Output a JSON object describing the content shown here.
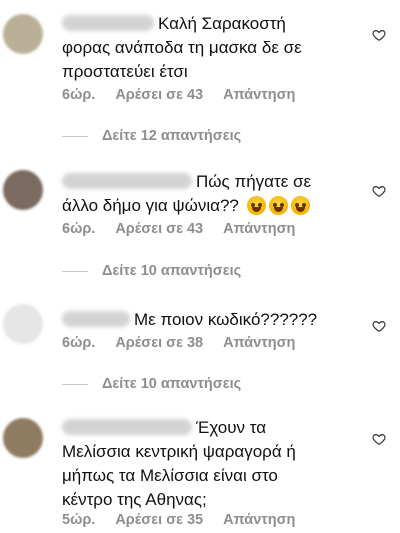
{
  "comments": [
    {
      "text": "Καλή Σαρακοστή\nφορας ανάποδα τη μασκα δε σε\nπροστατεύει έτσι",
      "time": "6ώρ.",
      "likes": "Αρέσει σε 43",
      "reply": "Απάντηση",
      "avatar_color": "#b9b097"
    },
    {
      "text": "Πώς πήγατε σε\nάλλο δήμο για ψώνια?? ",
      "time": "6ώρ.",
      "likes": "Αρέσει σε 43",
      "reply": "Απάντηση",
      "avatar_color": "#7a6a60"
    },
    {
      "text": "Με ποιον κωδικό??????",
      "time": "6ώρ.",
      "likes": "Αρέσει σε 38",
      "reply": "Απάντηση",
      "avatar_color": "#e6e6e6"
    },
    {
      "text": "Έχουν τα\nΜελίσσια κεντρική ψαραγορά ή\nμήπως τα Μελίσσια είναι στο\nκέντρο της Αθηνας;",
      "time": "5ώρ.",
      "likes": "Αρέσει σε 35",
      "reply": "Απάντηση",
      "avatar_color": "#8f7a62"
    }
  ],
  "view_replies": [
    "Δείτε 12 απαντήσεις",
    "Δείτε 10 απαντήσεις",
    "Δείτε 10 απαντήσεις"
  ],
  "icons": {
    "like": "heart-outline-icon",
    "emoji": "face-with-tears-of-joy"
  },
  "colors": {
    "text": "#111111",
    "meta": "#8e8e8e",
    "divider": "#c7c7c7"
  }
}
